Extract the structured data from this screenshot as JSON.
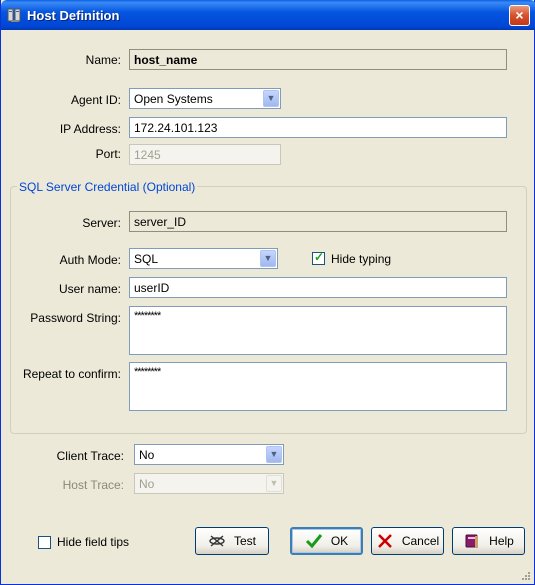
{
  "window": {
    "title": "Host Definition",
    "close": "×"
  },
  "form": {
    "name_label": "Name:",
    "name_value": "host_name",
    "agent_id_label": "Agent ID:",
    "agent_id_value": "Open Systems",
    "ip_label": "IP Address:",
    "ip_value": "172.24.101.123",
    "port_label": "Port:",
    "port_value": "1245"
  },
  "sql_group": {
    "title": "SQL Server Credential (Optional)",
    "server_label": "Server:",
    "server_value": "server_ID",
    "auth_label": "Auth Mode:",
    "auth_value": "SQL",
    "hide_typing_label": "Hide typing",
    "hide_typing_checked": true,
    "user_label": "User name:",
    "user_value": "userID",
    "password_label": "Password String:",
    "password_value": "********",
    "repeat_label": "Repeat to confirm:",
    "repeat_value": "********"
  },
  "trace": {
    "client_label": "Client Trace:",
    "client_value": "No",
    "host_label": "Host Trace:",
    "host_value": "No"
  },
  "footer": {
    "hide_tips_label": "Hide field tips",
    "hide_tips_checked": false,
    "test_label": "Test",
    "ok_label": "OK",
    "cancel_label": "Cancel",
    "help_label": "Help"
  },
  "colors": {
    "accent": "#0046d5",
    "window_bg": "#ece9d8"
  }
}
